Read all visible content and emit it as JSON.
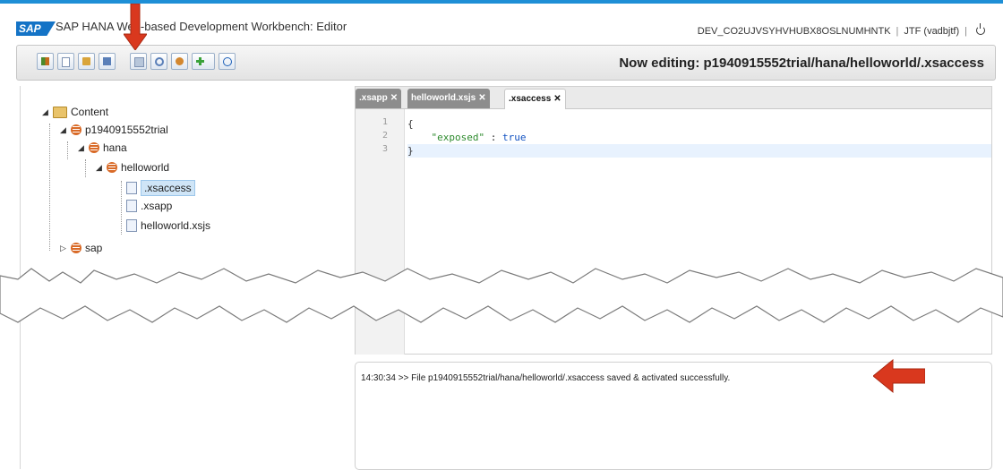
{
  "header": {
    "app_title": "SAP HANA Web-based Development Workbench: Editor",
    "system_id": "DEV_CO2UJVSYHVHUBX8OSLNUMHNTK",
    "user": "JTF (vadbjtf)",
    "separator": "|",
    "logo_text": "SAP"
  },
  "toolbar": {
    "buttons": [
      "synchronize-icon",
      "new-file-icon",
      "save-all-icon",
      "save-icon",
      "copy-icon",
      "search-icon",
      "settings-icon",
      "add-icon",
      "info-icon"
    ],
    "now_editing": "Now editing: p1940915552trial/hana/helloworld/.xsaccess"
  },
  "tree": {
    "root": "Content",
    "package": "p1940915552trial",
    "sub1": "hana",
    "sub2": "helloworld",
    "files": [
      ".xsaccess",
      ".xsapp",
      "helloworld.xsjs"
    ],
    "selected": ".xsaccess",
    "sibling": "sap"
  },
  "tabs": [
    {
      "label": ".xsapp",
      "close": "✕"
    },
    {
      "label": "helloworld.xsjs",
      "close": "✕"
    },
    {
      "label": ".xsaccess",
      "close": "✕"
    }
  ],
  "editor": {
    "line_numbers": [
      "1",
      "2",
      "3"
    ],
    "lines": [
      "{",
      "    \"exposed\" : true",
      "}"
    ],
    "key": "\"exposed\"",
    "sep": " : ",
    "value": "true"
  },
  "console": {
    "message": "14:30:34 >> File p1940915552trial/hana/helloworld/.xsaccess saved & activated successfully."
  },
  "colors": {
    "accent": "#1e8fd6",
    "annotation_arrow": "#d9381e"
  }
}
